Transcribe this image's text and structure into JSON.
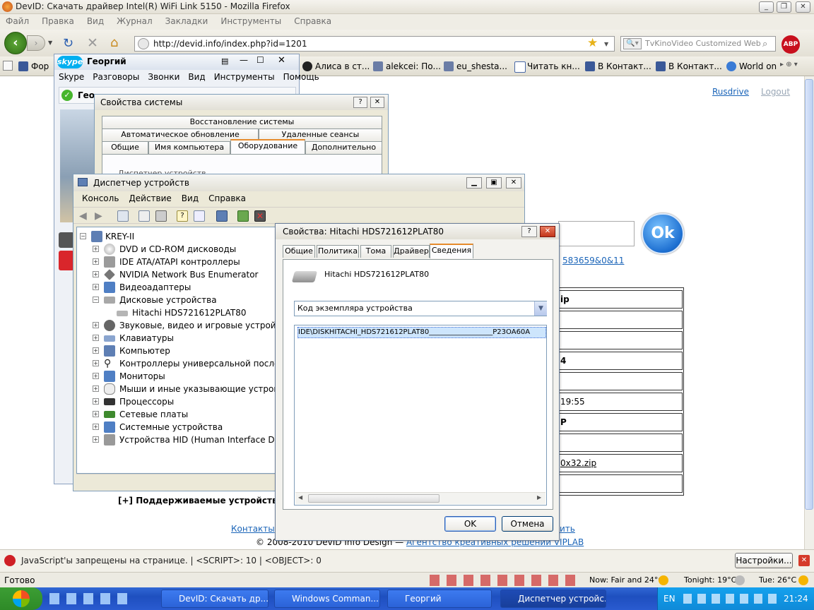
{
  "firefox": {
    "title": "DevID: Скачать драйвер Intel(R) WiFi Link 5150 - Mozilla Firefox",
    "menu": [
      "Файл",
      "Правка",
      "Вид",
      "Журнал",
      "Закладки",
      "Инструменты",
      "Справка"
    ],
    "url": "http://devid.info/index.php?id=1201",
    "search_placeholder": "TvKinoVideo Customized Web",
    "abp_label": "ABP",
    "bookmarks": [
      "Фор",
      "Алиса в ст...",
      "alekcei: По...",
      "eu_shesta...",
      "Читать кн...",
      "В Контакт...",
      "В Контакт...",
      "World on"
    ],
    "status_text": "Готово",
    "js_bar_text": "JavaScript'ы запрещены на странице. | <SCRIPT>: 10 | <OBJECT>: 0",
    "js_settings_button": "Настройки...",
    "weather": {
      "now": "Now: Fair and 24°C",
      "tonight": "Tonight: 19°C",
      "tue": "Tue: 26°C"
    }
  },
  "web": {
    "rusdrive_link": "Rusdrive",
    "logout_link": "Logout",
    "ok_button": "Ok",
    "device_link_tail": "583659&0&11",
    "table_cells": [
      "ip",
      "",
      "",
      "4",
      "",
      "19:55",
      "P",
      "",
      "0x32.zip",
      ""
    ],
    "supported_devices": "[+] Поддерживаемые устройства",
    "contacts_link": "Контакты",
    "tail_link": "ить",
    "footer_text": "© 2008-2010 DevID Info Design — ",
    "footer_link": "Агентство креативных решений VIPLAB"
  },
  "skype": {
    "title": "Георгий",
    "logo": "skype",
    "menu": [
      "Skype",
      "Разговоры",
      "Звонки",
      "Вид",
      "Инструменты",
      "Помощь"
    ],
    "status_name": "Гео"
  },
  "sysprops": {
    "title": "Свойства системы",
    "tabs_row1": [
      "Восстановление системы"
    ],
    "tabs_row2": [
      "Автоматическое обновление",
      "Удаленные сеансы"
    ],
    "tabs_row3": [
      "Общие",
      "Имя компьютера",
      "Оборудование",
      "Дополнительно"
    ],
    "content_peek": "Диспетчер устройств"
  },
  "devmgr": {
    "title": "Диспетчер устройств",
    "menu": [
      "Консоль",
      "Действие",
      "Вид",
      "Справка"
    ],
    "root": "KREY-II",
    "items": [
      "DVD и CD-ROM дисководы",
      "IDE ATA/ATAPI контроллеры",
      "NVIDIA Network Bus Enumerator",
      "Видеоадаптеры",
      "Дисковые устройства",
      "Hitachi HDS721612PLAT80",
      "Звуковые, видео и игровые устройства",
      "Клавиатуры",
      "Компьютер",
      "Контроллеры универсальной последо",
      "Мониторы",
      "Мыши и иные указывающие устройства",
      "Процессоры",
      "Сетевые платы",
      "Системные устройства",
      "Устройства HID (Human Interface Device"
    ]
  },
  "hdd": {
    "title": "Свойства: Hitachi HDS721612PLAT80",
    "tabs": [
      "Общие",
      "Политика",
      "Тома",
      "Драйвер",
      "Сведения"
    ],
    "device_name": "Hitachi HDS721612PLAT80",
    "property": "Код экземпляра устройства",
    "value": "IDE\\DISKHITACHI_HDS721612PLAT80__________________P23OA60A",
    "ok": "OK",
    "cancel": "Отмена"
  },
  "taskbar": {
    "tasks": [
      "DevID: Скачать др...",
      "Windows Comman...",
      "Георгий",
      "Диспетчер устройс..."
    ],
    "lang": "EN",
    "clock": "21:24"
  },
  "colors": {
    "link": "#1a64b8",
    "xp_blue": "#2a5bd0",
    "selection": "#cde5fc"
  }
}
